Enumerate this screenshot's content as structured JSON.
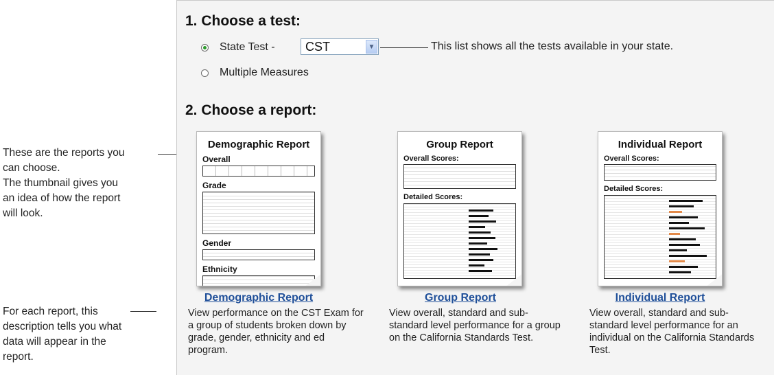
{
  "left_notes": {
    "reports_note": [
      "These are the reports you",
      "can choose.",
      "The thumbnail gives you",
      "an idea of how the report",
      "will look."
    ],
    "description_note": [
      "For each report, this",
      "description tells you what",
      "data will appear in the",
      "report."
    ]
  },
  "step1": {
    "title": "1. Choose a test:",
    "state_test_label": "State Test -",
    "state_test_selected": "CST",
    "multiple_measures_label": "Multiple Measures",
    "callout": "This list shows all the tests available in your state."
  },
  "step2": {
    "title": "2. Choose a report:",
    "reports": [
      {
        "thumb_title": "Demographic Report",
        "sections": [
          "Overall",
          "Grade",
          "Gender",
          "Ethnicity"
        ],
        "link": "Demographic Report",
        "description": "View performance on the CST Exam for a group of students broken down by grade, gender, ethnicity and ed program."
      },
      {
        "thumb_title": "Group Report",
        "sections": [
          "Overall Scores:",
          "Detailed Scores:"
        ],
        "link": "Group Report",
        "description": "View overall, standard and sub-standard level performance for a group on the California Standards Test."
      },
      {
        "thumb_title": "Individual Report",
        "sections": [
          "Overall Scores:",
          "Detailed Scores:"
        ],
        "link": "Individual Report",
        "description": "View overall, standard and sub-standard level performance for an individual on the California Standards Test."
      }
    ]
  },
  "colors": {
    "panel_bg": "#f4f4f4",
    "link": "#1f4f99",
    "radio_selected": "#2c9a2c"
  }
}
